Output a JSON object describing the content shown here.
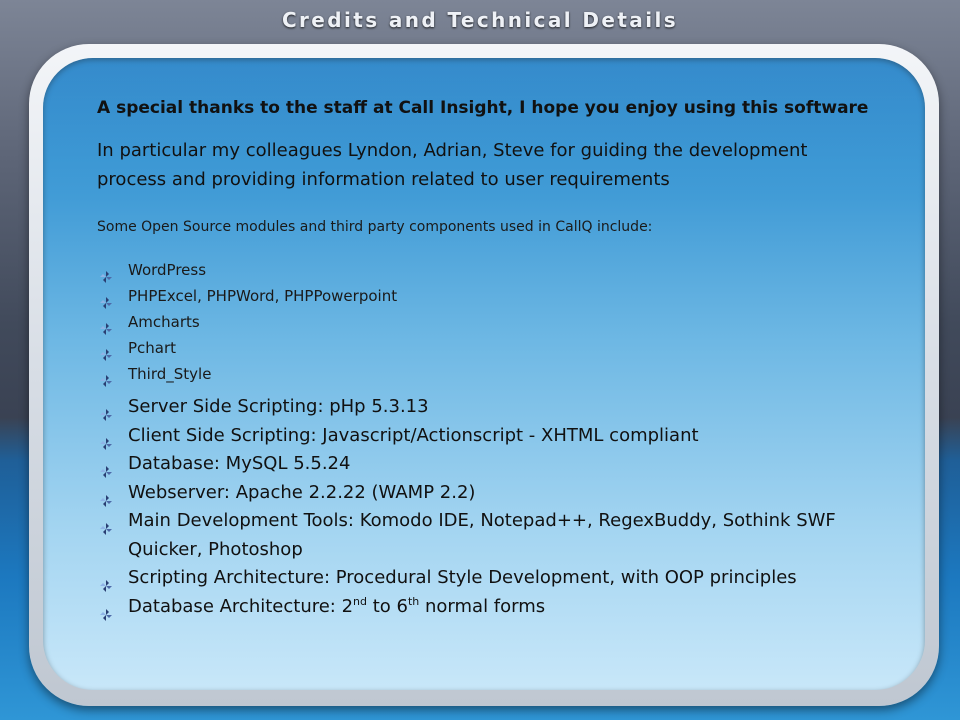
{
  "title": "Credits and Technical Details",
  "thanks": "A special thanks to the staff at Call Insight, I hope you enjoy using this software",
  "colleagues": "In particular my colleagues Lyndon, Adrian, Steve for guiding the development process and providing information related to user requirements",
  "intro": "Some Open Source modules and third party components used in CallQ include:",
  "modules": [
    "WordPress",
    "PHPExcel, PHPWord, PHPPowerpoint",
    "Amcharts",
    "Pchart",
    "Third_Style"
  ],
  "tech": [
    "Server Side Scripting: pHp 5.3.13",
    "Client Side Scripting: Javascript/Actionscript - XHTML compliant",
    "Database:  MySQL 5.5.24",
    "Webserver:  Apache 2.2.22 (WAMP 2.2)",
    "Main Development Tools: Komodo IDE, Notepad++, RegexBuddy, Sothink SWF Quicker, Photoshop",
    "Scripting Architecture: Procedural Style Development, with OOP principles"
  ],
  "db_arch": {
    "prefix": "Database Architecture: 2",
    "sup1": "nd",
    "middle": " to 6",
    "sup2": "th",
    "suffix": " normal forms"
  }
}
